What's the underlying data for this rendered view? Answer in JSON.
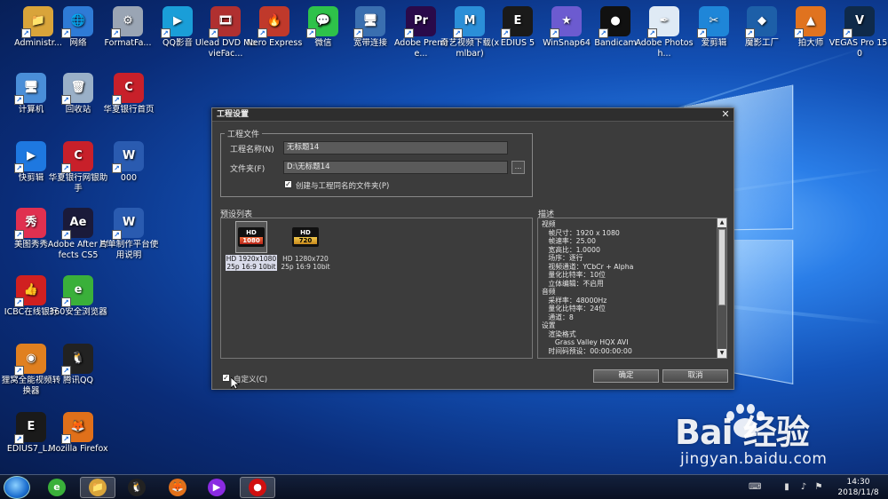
{
  "desktop_icons": [
    {
      "label": "Administr...",
      "color": "#d9a43a",
      "glyph": "📁"
    },
    {
      "label": "网络",
      "color": "#2e7bd6",
      "glyph": "🌐"
    },
    {
      "label": "FormatFa...",
      "color": "#9aa5b4",
      "glyph": "⚙"
    },
    {
      "label": "QQ影音",
      "color": "#1a9ed8",
      "glyph": "▶"
    },
    {
      "label": "Ulead DVD MovieFac...",
      "color": "#b03030",
      "glyph": "🎞"
    },
    {
      "label": "Nero Express",
      "color": "#c0392b",
      "glyph": "🔥"
    },
    {
      "label": "微信",
      "color": "#2ec24a",
      "glyph": "💬"
    },
    {
      "label": "宽带连接",
      "color": "#3a6fb0",
      "glyph": "🖥"
    },
    {
      "label": "Adobe Premie...",
      "color": "#2a0a4a",
      "glyph": "Pr"
    },
    {
      "label": "奇艺视频下载(xmlbar)",
      "color": "#2b8fd8",
      "glyph": "M"
    },
    {
      "label": "EDIUS 5",
      "color": "#1a1a1a",
      "glyph": "E"
    },
    {
      "label": "WinSnap64",
      "color": "#6c5bd0",
      "glyph": "★"
    },
    {
      "label": "Bandicam",
      "color": "#111111",
      "glyph": "●"
    },
    {
      "label": "Adobe Photosh...",
      "color": "#dfeaf5",
      "glyph": "✒"
    },
    {
      "label": "爱剪辑",
      "color": "#1f86d8",
      "glyph": "✂"
    },
    {
      "label": "魔影工厂",
      "color": "#1d5fa8",
      "glyph": "◆"
    },
    {
      "label": "拍大师",
      "color": "#e0731f",
      "glyph": "▲"
    },
    {
      "label": "VEGAS Pro 15.0",
      "color": "#0f2a4a",
      "glyph": "V"
    },
    {
      "label": "计算机",
      "color": "#4a8ed8",
      "glyph": "🖥"
    },
    {
      "label": "回收站",
      "color": "#9ab0c8",
      "glyph": "🗑"
    },
    {
      "label": "华夏银行首页",
      "color": "#c8202a",
      "glyph": "C"
    },
    {
      "label": "快剪辑",
      "color": "#1e78e0",
      "glyph": "▶"
    },
    {
      "label": "华夏银行网银助手",
      "color": "#c8202a",
      "glyph": "C"
    },
    {
      "label": "000",
      "color": "#2a5bb0",
      "glyph": "W"
    },
    {
      "label": "美图秀秀",
      "color": "#e03050",
      "glyph": "秀"
    },
    {
      "label": "Adobe After Effects CS5",
      "color": "#1a1a3a",
      "glyph": "Ae"
    },
    {
      "label": "片单制作平台使用说明",
      "color": "#2a5bb0",
      "glyph": "W"
    },
    {
      "label": "ICBC在线银行",
      "color": "#d02020",
      "glyph": "👍"
    },
    {
      "label": "360安全浏览器",
      "color": "#3ab03a",
      "glyph": "e"
    },
    {
      "label": "狸窝全能视频转换器",
      "color": "#e08020",
      "glyph": "◉"
    },
    {
      "label": "腾讯QQ",
      "color": "#222222",
      "glyph": "🐧"
    },
    {
      "label": "EDIUS7_L...",
      "color": "#1a1a1a",
      "glyph": "E"
    },
    {
      "label": "Mozilla Firefox",
      "color": "#e0701a",
      "glyph": "🦊"
    }
  ],
  "dialog": {
    "title": "工程设置",
    "close_glyph": "✕",
    "project_group": {
      "title": "工程文件",
      "name_label": "工程名称(N)",
      "name_value": "无标题14",
      "folder_label": "文件夹(F)",
      "folder_value": "D:\\无标题14",
      "browse_label": "...",
      "create_folder_label": "创建与工程同名的文件夹(P)",
      "create_folder_checked": true
    },
    "preset_list": {
      "label": "预设列表",
      "items": [
        {
          "badge_top": "HD",
          "badge_bottom": "1080",
          "caption": "HD 1920x1080 25p 16:9 10bit",
          "selected": true
        },
        {
          "badge_top": "HD",
          "badge_bottom": "720",
          "caption": "HD 1280x720 25p 16:9 10bit",
          "selected": false
        }
      ]
    },
    "description": {
      "label": "描述",
      "lines": [
        "视频",
        "  帧尺寸：1920 x 1080",
        "  帧速率：25.00",
        "  宽高比：1.0000",
        "  场序：逐行",
        "  视频通道：YCbCr + Alpha",
        "  量化比特率：10位",
        "  立体编辑：不启用",
        "音频",
        "  采样率：48000Hz",
        "  量化比特率：24位",
        "  通道：8",
        "设置",
        "  渲染格式",
        "    Grass Valley HQX AVI",
        "  时间码预设：00:00:00:00"
      ]
    },
    "custom_label": "自定义(C)",
    "custom_checked": true,
    "ok_label": "确定",
    "cancel_label": "取消"
  },
  "taskbar": {
    "apps": [
      {
        "glyph": "e",
        "color": "#3ab03a"
      },
      {
        "glyph": "📁",
        "color": "#d9a43a"
      },
      {
        "glyph": "🐧",
        "color": "#222"
      },
      {
        "glyph": "🦊",
        "color": "#e0701a"
      },
      {
        "glyph": "▶",
        "color": "#8a2be2"
      },
      {
        "glyph": "●",
        "color": "#d01010"
      }
    ],
    "time": "14:30",
    "date": "2018/11/8"
  },
  "watermark": {
    "brand": "Bai  经验",
    "url": "jingyan.baidu.com"
  }
}
